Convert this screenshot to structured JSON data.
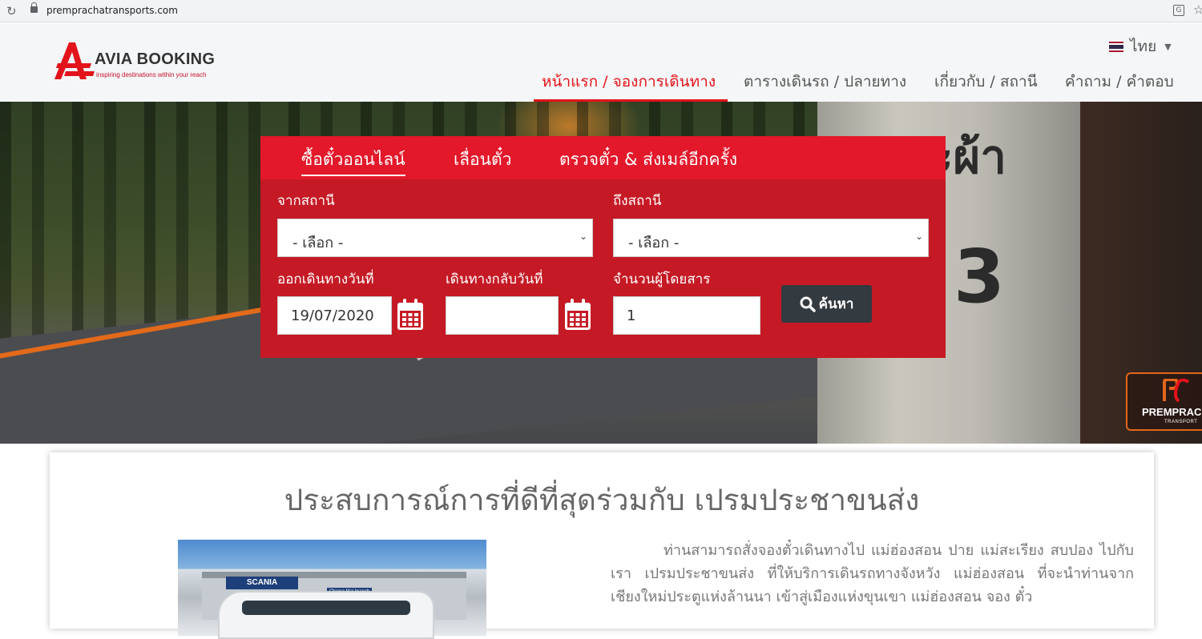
{
  "browser": {
    "url": "premprachatransports.com"
  },
  "header": {
    "brand": "AVIA BOOKING",
    "tagline": "inspiring destinations within your reach",
    "language": "ไทย",
    "nav": [
      {
        "label": "หน้าแรก / จองการเดินทาง",
        "active": true
      },
      {
        "label": "ตารางเดินรถ / ปลายทาง",
        "active": false
      },
      {
        "label": "เกี่ยวกับ / สถานี",
        "active": false
      },
      {
        "label": "คำถาม / คำตอบ",
        "active": false
      }
    ]
  },
  "hero": {
    "stone_text": "มะผ้า",
    "stone_number": "3",
    "badge_name": "PREMPRACH",
    "badge_sub": "TRANSPORT"
  },
  "booking": {
    "tabs": [
      {
        "label": "ซื้อตั๋วออนไลน์",
        "active": true
      },
      {
        "label": "เลื่อนตั๋ว",
        "active": false
      },
      {
        "label": "ตรวจตั๋ว & ส่งเมล์อีกครั้ง",
        "active": false
      }
    ],
    "from_label": "จากสถานี",
    "from_value": "- เลือก -",
    "to_label": "ถึงสถานี",
    "to_value": "- เลือก -",
    "depart_label": "ออกเดินทางวันที่",
    "depart_value": "19/07/2020",
    "return_label": "เดินทางกลับวันที่",
    "return_value": "",
    "passengers_label": "จำนวนผู้โดยสาร",
    "passengers_value": "1",
    "search_label": "ค้นหา"
  },
  "content": {
    "heading": "ประสบการณ์การที่ดีที่สุดร่วมกับ เปรมประชาขนส่ง",
    "image_sign": "SCANIA",
    "image_sign2": "Chiang Mai branch",
    "paragraph": "ท่านสามารถสั่งจองตั๋วเดินทางไป แม่ฮ่องสอน ปาย แม่สะเรียง สบปอง ไปกับเรา เปรมประชาขนส่ง ที่ให้บริการเดินรถทางจังหวัง แม่ฮ่องสอน ที่จะนำท่านจากเชียงใหม่ประตูแห่งล้านนา เข้าสู่เมืองแห่งขุนเขา แม่ฮ่องสอน จอง ตั๋ว"
  },
  "colors": {
    "accent": "#e3131b",
    "panel": "#c51a25",
    "tabbar": "#e3182a",
    "button": "#333a40"
  }
}
